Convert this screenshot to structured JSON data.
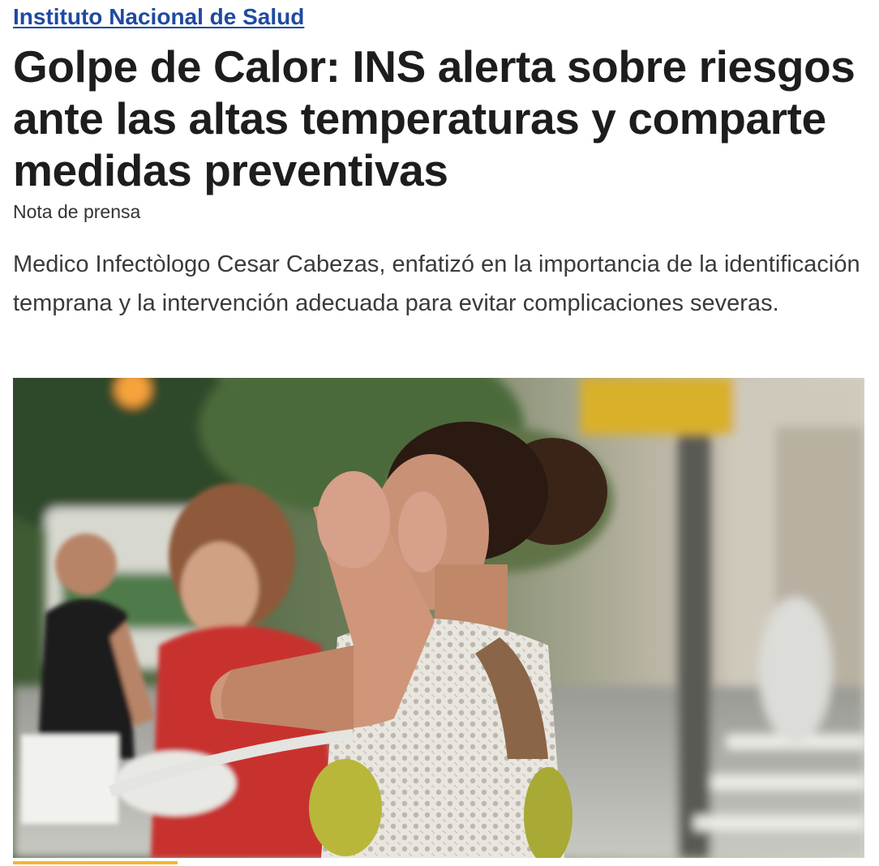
{
  "header": {
    "org_link": "Instituto Nacional de Salud"
  },
  "article": {
    "headline": "Golpe de Calor: INS alerta sobre riesgos ante las altas temperaturas y comparte medidas preventivas",
    "kicker": "Nota de prensa",
    "summary": "Medico Infectòlogo Cesar Cabezas, enfatizó en la importancia de la identificación temprana y la intervención adecuada para evitar complicaciones severas."
  },
  "colors": {
    "link": "#1f4aa0",
    "accent_bar": "#f4b82e",
    "text_primary": "#1d1d1d",
    "text_secondary": "#3a3a3a"
  }
}
